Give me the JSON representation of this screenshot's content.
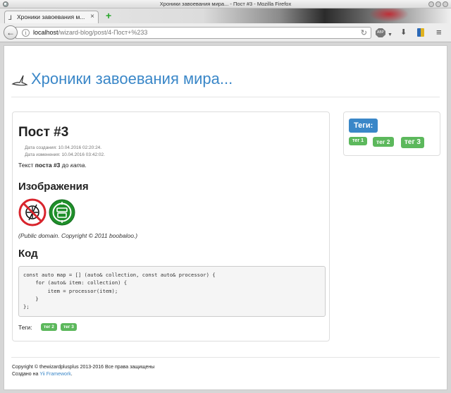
{
  "window": {
    "title": "Хроники завоевания мира... - Пост #3 - Mozilla Firefox"
  },
  "browser": {
    "tab_label": "Хроники завоевания м...",
    "tab_close": "×",
    "new_tab": "+",
    "url_host": "localhost",
    "url_path": "/wizard-blog/post/4-Пост+%233",
    "abp_label": "ABP"
  },
  "site": {
    "title": "Хроники завоевания мира..."
  },
  "post": {
    "title": "Пост #3",
    "created": "Дата создания: 10.04.2016 02:20:24.",
    "updated": "Дата изменения: 10.04.2016 03:42:02.",
    "text_prefix": "Текст ",
    "text_bold": "поста #3",
    "text_middle": " до ",
    "text_italic": "ката",
    "text_suffix": ".",
    "images_heading": "Изображения",
    "image_note": "(Public domain. Copyright © 2011 boobaloo.)",
    "code_heading": "Код",
    "code": "const auto map = [] (auto& collection, const auto& processor) {\n    for (auto& item: collection) {\n        item = processor(item);\n    }\n};",
    "tags_label": "Теги:",
    "tags": [
      "тег 2",
      "тег 3"
    ]
  },
  "sidebar": {
    "heading": "Теги:",
    "tags": [
      "тег 1",
      "тег 2",
      "тег 3"
    ]
  },
  "footer": {
    "copyright": "Copyright © thewizardplusplus 2013-2016 Все права защищены",
    "created_prefix": "Создано на ",
    "framework_link": "Yii Framework",
    "created_suffix": "."
  },
  "colors": {
    "link_blue": "#3a87c8",
    "tag_green": "#5cb85c"
  }
}
